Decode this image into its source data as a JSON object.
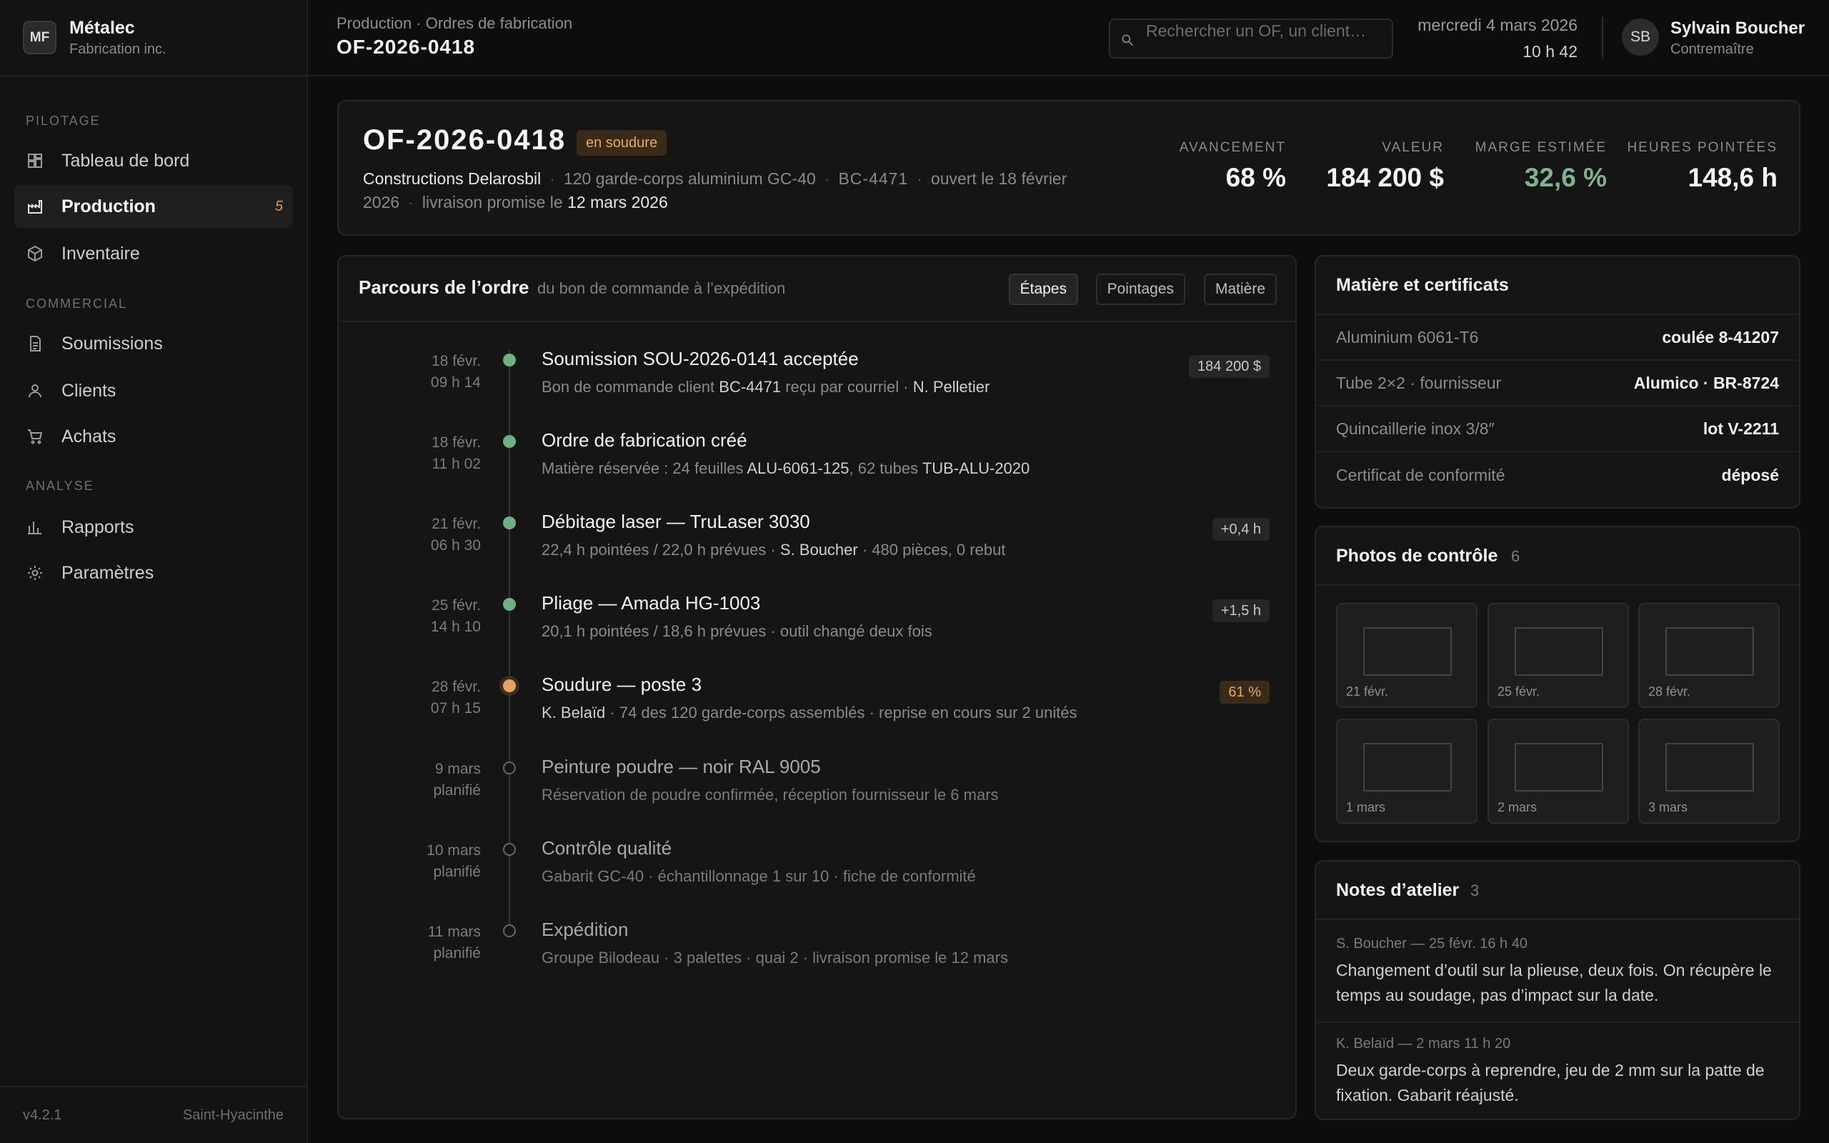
{
  "brand": {
    "logo": "MF",
    "name": "Métalec",
    "subtitle": "Fabrication inc."
  },
  "nav": {
    "sections": {
      "pilotage": "PILOTAGE",
      "commercial": "COMMERCIAL",
      "analyse": "ANALYSE"
    },
    "items": [
      {
        "label": "Tableau de bord",
        "icon": "dashboard-icon"
      },
      {
        "label": "Production",
        "icon": "factory-icon",
        "badge": "5",
        "active": true
      },
      {
        "label": "Inventaire",
        "icon": "box-icon"
      },
      {
        "label": "Soumissions",
        "icon": "document-icon"
      },
      {
        "label": "Clients",
        "icon": "user-icon"
      },
      {
        "label": "Achats",
        "icon": "cart-icon"
      },
      {
        "label": "Rapports",
        "icon": "bar-chart-icon"
      },
      {
        "label": "Paramètres",
        "icon": "gear-icon"
      }
    ]
  },
  "footer": {
    "version": "v4.2.1",
    "location": "Saint-Hyacinthe"
  },
  "topbar": {
    "breadcrumb": "Production · Ordres de fabrication",
    "title": "OF-2026-0418",
    "search_placeholder": "Rechercher un OF, un client…",
    "date": "mercredi 4 mars 2026",
    "time": "10 h 42",
    "user": {
      "initials": "SB",
      "name": "Sylvain Boucher",
      "role": "Contremaître"
    }
  },
  "summary": {
    "order_id": "OF-2026-0418",
    "status": "en soudure",
    "client": "Constructions Delarosbil",
    "product": "120 garde-corps aluminium GC-40",
    "po": "BC-4471",
    "opened": "ouvert le 18 février 2026",
    "delivery_label": "livraison promise le",
    "delivery_date": "12 mars 2026",
    "kpis": [
      {
        "label": "AVANCEMENT",
        "value": "68 %"
      },
      {
        "label": "VALEUR",
        "value": "184 200 $"
      },
      {
        "label": "MARGE ESTIMÉE",
        "value": "32,6 %"
      },
      {
        "label": "HEURES POINTÉES",
        "value": "148,6 h"
      }
    ]
  },
  "timeline": {
    "title": "Parcours de l’ordre",
    "subtitle": "du bon de commande à l’expédition",
    "tabs": [
      "Étapes",
      "Pointages",
      "Matière"
    ],
    "steps": [
      {
        "date": "18 févr.",
        "time": "09 h 14",
        "status": "done",
        "title": "Soumission SOU-2026-0141 acceptée",
        "desc": [
          "Bon de commande client ",
          "BC-4471",
          " reçu par courriel · ",
          "N. Pelletier",
          ""
        ],
        "badge": "184 200 $"
      },
      {
        "date": "18 févr.",
        "time": "11 h 02",
        "status": "done",
        "title": "Ordre de fabrication créé",
        "desc": [
          "Matière réservée : 24 feuilles ",
          "ALU-6061-125",
          ", 62 tubes ",
          "TUB-ALU-2020",
          ""
        ],
        "badge": ""
      },
      {
        "date": "21 févr.",
        "time": "06 h 30",
        "status": "done",
        "title": "Débitage laser — TruLaser 3030",
        "desc": [
          "22,4 h pointées / 22,0 h prévues · ",
          "S. Boucher",
          " · 480 pièces, 0 rebut",
          "",
          ""
        ],
        "badge": "+0,4 h"
      },
      {
        "date": "25 févr.",
        "time": "14 h 10",
        "status": "done",
        "title": "Pliage — Amada HG-1003",
        "desc": [
          "20,1 h pointées / 18,6 h prévues · outil changé deux fois",
          "",
          "",
          "",
          ""
        ],
        "badge": "+1,5 h"
      },
      {
        "date": "28 févr.",
        "time": "07 h 15",
        "status": "current",
        "title": "Soudure — poste 3",
        "desc": [
          "",
          "K. Belaïd",
          " · 74 des 120 garde-corps assemblés · reprise en cours sur 2 unités",
          "",
          ""
        ],
        "badge": "61 %"
      },
      {
        "date": "9 mars",
        "time": "planifié",
        "status": "planned",
        "title": "Peinture poudre — noir RAL 9005",
        "desc": [
          "Réservation de poudre confirmée, réception fournisseur le 6 mars",
          "",
          "",
          "",
          ""
        ],
        "badge": ""
      },
      {
        "date": "10 mars",
        "time": "planifié",
        "status": "planned",
        "title": "Contrôle qualité",
        "desc": [
          "Gabarit GC-40 · échantillonnage 1 sur 10 · fiche de conformité",
          "",
          "",
          "",
          ""
        ],
        "badge": ""
      },
      {
        "date": "11 mars",
        "time": "planifié",
        "status": "planned",
        "title": "Expédition",
        "desc": [
          "Groupe Bilodeau · 3 palettes · quai 2 · livraison promise le 12 mars",
          "",
          "",
          "",
          ""
        ],
        "badge": ""
      }
    ]
  },
  "materials": {
    "title": "Matière et certificats",
    "rows": [
      {
        "label": "Aluminium 6061-T6",
        "value": "coulée 8-41207"
      },
      {
        "label": "Tube 2×2 · fournisseur",
        "value": "Alumico · BR-8724"
      },
      {
        "label": "Quincaillerie inox 3/8″",
        "value": "lot V-2211"
      },
      {
        "label": "Certificat de conformité",
        "value": "déposé"
      }
    ]
  },
  "photos": {
    "title": "Photos de contrôle",
    "count": "6",
    "items": [
      "21 févr.",
      "25 févr.",
      "28 févr.",
      "1 mars",
      "2 mars",
      "3 mars"
    ]
  },
  "notes": {
    "title": "Notes d’atelier",
    "count": "3",
    "items": [
      {
        "meta": "S. Boucher — 25 févr. 16 h 40",
        "text": "Changement d’outil sur la plieuse, deux fois. On récupère le temps au soudage, pas d’impact sur la date."
      },
      {
        "meta": "K. Belaïd — 2 mars 11 h 20",
        "text": "Deux garde-corps à reprendre, jeu de 2 mm sur la patte de fixation. Gabarit réajusté."
      }
    ]
  },
  "colors": {
    "accent_amber": "#e3a55f",
    "done_green": "#6fb083",
    "margin_green": "#7fb38d"
  }
}
